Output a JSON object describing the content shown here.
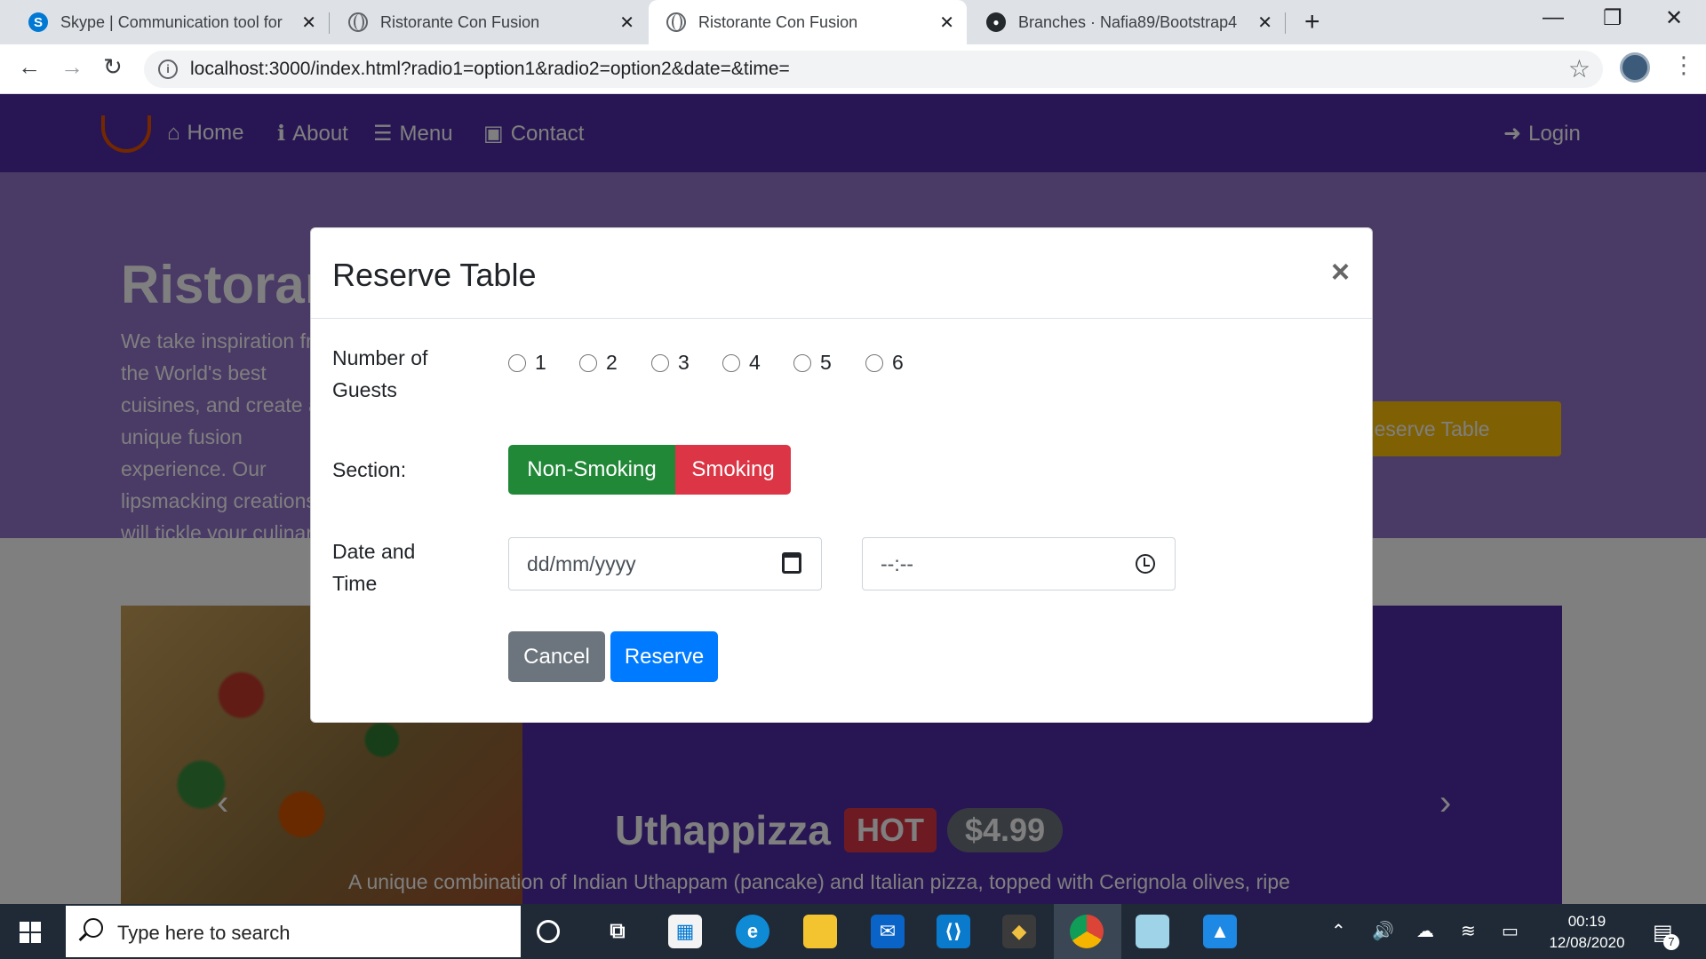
{
  "browser": {
    "tabs": [
      {
        "title": "Skype | Communication tool for free",
        "icon": "skype-icon"
      },
      {
        "title": "Ristorante Con Fusion",
        "icon": "globe-icon"
      },
      {
        "title": "Ristorante Con Fusion",
        "icon": "globe-icon",
        "active": true
      },
      {
        "title": "Branches · Nafia89/Bootstrap4",
        "icon": "github-icon"
      }
    ],
    "close_glyph": "✕",
    "new_tab_glyph": "+",
    "url": "localhost:3000/index.html?radio1=option1&radio2=option2&date=&time=",
    "info_glyph": "i",
    "window_controls": {
      "minimize": "—",
      "restore": "❐",
      "close": "✕"
    }
  },
  "site": {
    "nav": {
      "home": "Home",
      "about": "About",
      "menu": "Menu",
      "contact": "Contact",
      "login": "Login"
    },
    "jumbotron": {
      "title": "Ristorante con Fusion",
      "text": "We take inspiration from the World's best cuisines, and create a unique fusion experience. Our lipsmacking creations will tickle your culinary senses!",
      "reserve_button": "Reserve Table"
    },
    "carousel": {
      "dish": "Uthappizza",
      "badge": "HOT",
      "price": "$4.99",
      "description": "A unique combination of Indian Uthappam (pancake) and Italian pizza, topped with Cerignola olives, ripe"
    }
  },
  "modal": {
    "title": "Reserve Table",
    "close_glyph": "×",
    "guests_label": "Number of Guests",
    "guest_options": [
      "1",
      "2",
      "3",
      "4",
      "5",
      "6"
    ],
    "section_label": "Section:",
    "section_options": [
      "Non-Smoking",
      "Smoking"
    ],
    "datetime_label": "Date and Time",
    "date_placeholder": "dd/mm/yyyy",
    "time_placeholder": "--:--",
    "cancel_label": "Cancel",
    "reserve_label": "Reserve"
  },
  "taskbar": {
    "search_placeholder": "Type here to search",
    "time": "00:19",
    "date": "12/08/2020",
    "notifications": "7"
  },
  "colors": {
    "navbar": "#512da8",
    "jumbotron": "#9575cd",
    "non_smoking": "#218838",
    "smoking": "#dc3545",
    "cancel": "#6c757d",
    "reserve": "#007bff",
    "reserve_table_button": "#ffc107"
  }
}
